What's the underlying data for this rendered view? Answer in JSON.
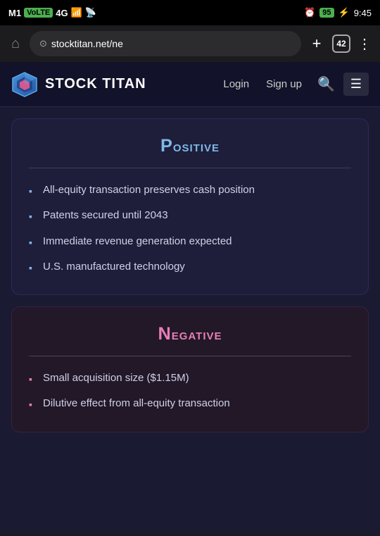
{
  "statusBar": {
    "carrier": "M1",
    "carrierBadge": "VoLTE",
    "signal": "4G",
    "time": "9:45",
    "batteryPercent": "95",
    "alarmIcon": "⏰"
  },
  "browserBar": {
    "url": "stocktitan.net/ne",
    "tabCount": "42",
    "homeIcon": "⌂",
    "addIcon": "+",
    "menuIcon": "⋮"
  },
  "navBar": {
    "brandName": "STOCK TITAN",
    "loginLabel": "Login",
    "signupLabel": "Sign up",
    "searchAriaLabel": "Search",
    "menuAriaLabel": "Menu"
  },
  "positiveCard": {
    "title": "Positive",
    "items": [
      "All-equity transaction preserves cash position",
      "Patents secured until 2043",
      "Immediate revenue generation expected",
      "U.S. manufactured technology"
    ]
  },
  "negativeCard": {
    "title": "Negative",
    "items": [
      "Small acquisition size ($1.15M)",
      "Dilutive effect from all-equity transaction"
    ]
  }
}
